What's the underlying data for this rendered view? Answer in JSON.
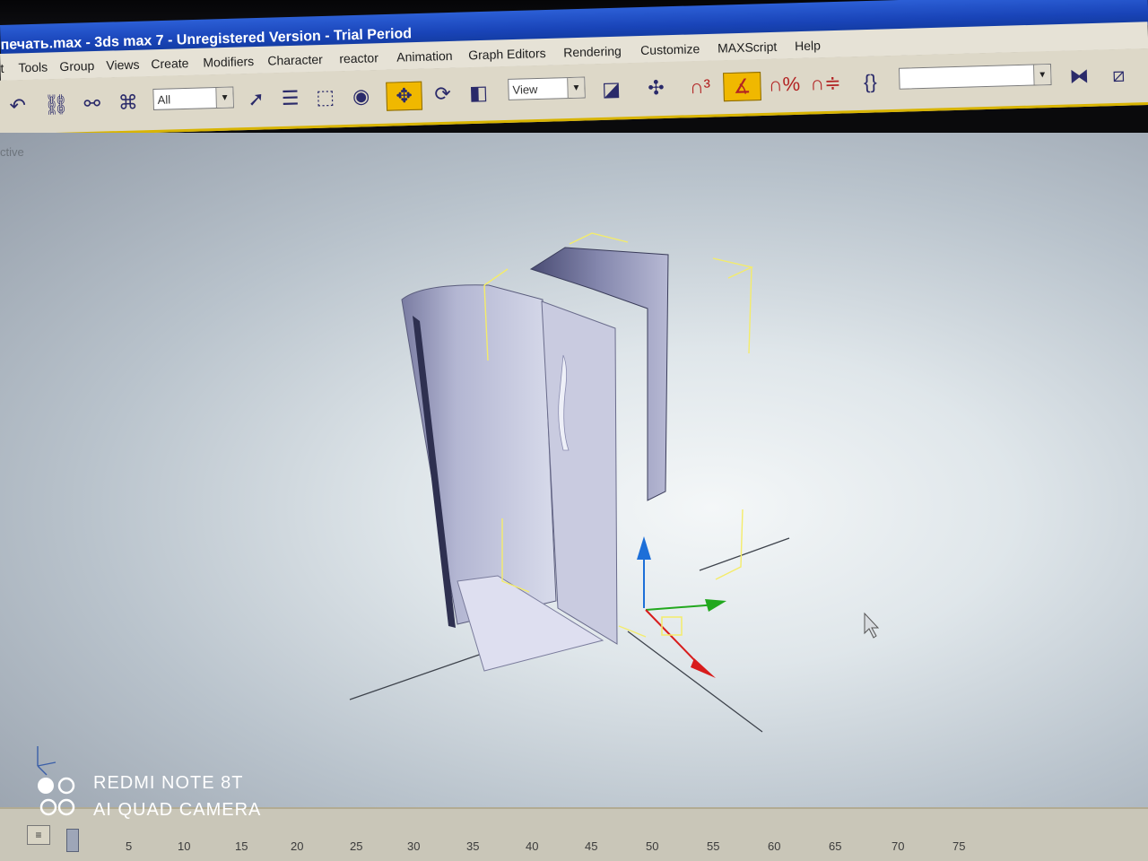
{
  "window": {
    "title": "печать.max - 3ds max 7  - Unregistered Version - Trial Period"
  },
  "menu": {
    "items": [
      "t",
      "Tools",
      "Group",
      "Views",
      "Create",
      "Modifiers",
      "Character",
      "reactor",
      "Animation",
      "Graph Editors",
      "Rendering",
      "Customize",
      "MAXScript",
      "Help"
    ]
  },
  "toolbar": {
    "selection_filter": "All",
    "reference_coord": "View",
    "named_selection": ""
  },
  "viewport": {
    "label": "ctive"
  },
  "timeline": {
    "ticks": [
      "5",
      "10",
      "15",
      "20",
      "25",
      "30",
      "35",
      "40",
      "45",
      "50",
      "55",
      "60",
      "65",
      "70",
      "75"
    ]
  },
  "watermark": {
    "line1": "REDMI NOTE 8T",
    "line2": "AI QUAD CAMERA"
  },
  "colors": {
    "title_bar": "#1944b8",
    "active_tool": "#f0b800",
    "gizmo_x": "#d81c1c",
    "gizmo_y": "#22a81e",
    "gizmo_z": "#1d6fd8",
    "selection_bracket": "#f4ec6a"
  }
}
